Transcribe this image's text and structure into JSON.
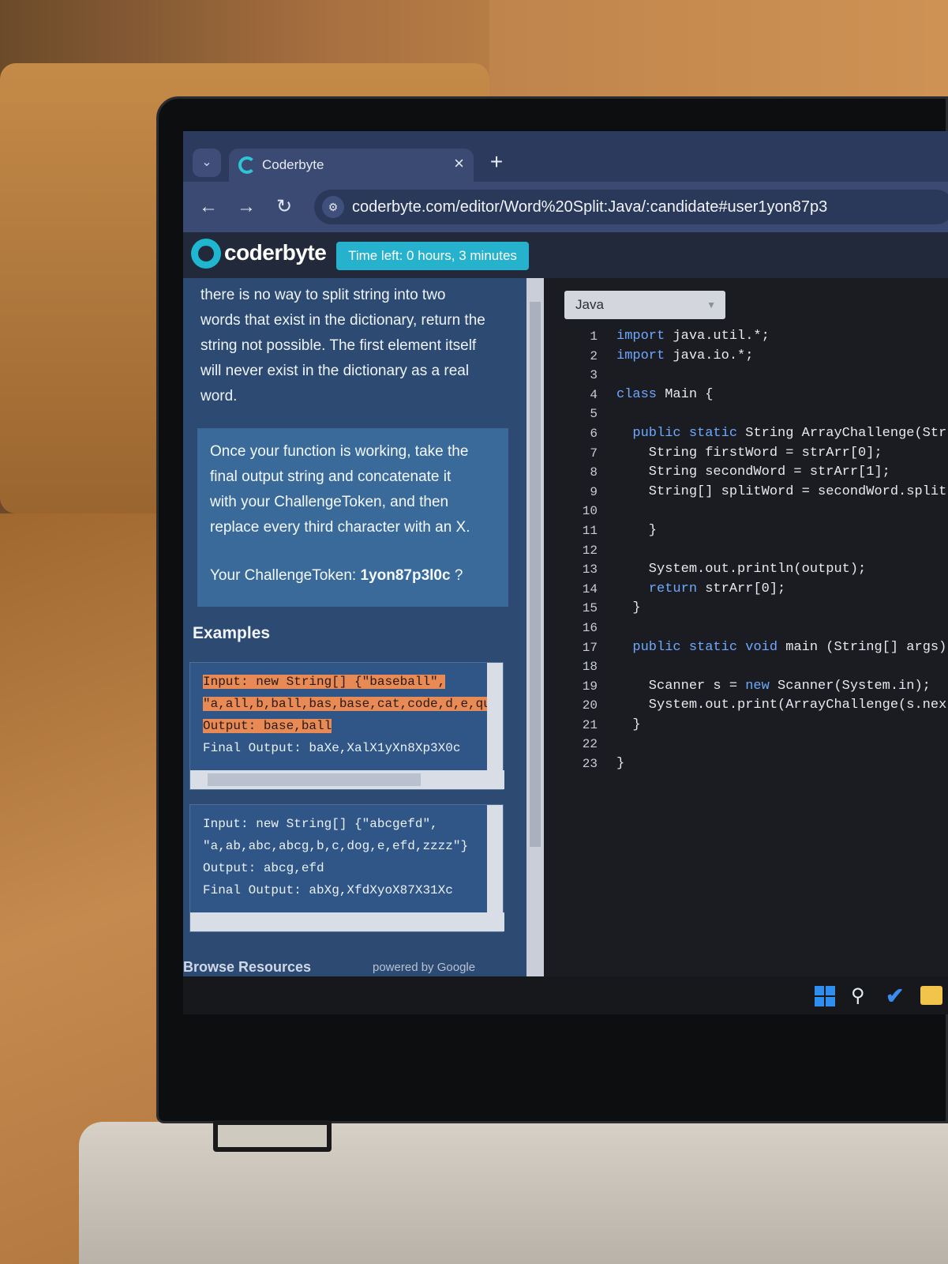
{
  "browser": {
    "tab_title": "Coderbyte",
    "url": "coderbyte.com/editor/Word%20Split:Java/:candidate#user1yon87p3"
  },
  "header": {
    "logo": "coderbyte",
    "timer": "Time left: 0 hours, 3 minutes"
  },
  "challenge": {
    "prose_lines": [
      "there is no way to split string into two",
      "words that exist in the dictionary, return the",
      "string not possible. The first element itself",
      "will never exist in the dictionary as a real",
      "word."
    ],
    "note_lines": [
      "Once your function is working, take the",
      "final output string and concatenate it",
      "with your ChallengeToken, and then",
      "replace every third character with an X."
    ],
    "token_label": "Your ChallengeToken:",
    "token_value": "1yon87p3l0c",
    "token_help": "?",
    "examples_heading": "Examples",
    "example1": [
      "Input: new String[] {\"baseball\",",
      "\"a,all,b,ball,bas,base,cat,code,d,e,qu",
      "Output: base,ball",
      "Final Output: baXe,XalX1yXn8Xp3X0c"
    ],
    "example2": [
      "Input: new String[] {\"abcgefd\",",
      "\"a,ab,abc,abcg,b,c,dog,e,efd,zzzz\"}",
      "Output: abcg,efd",
      "Final Output: abXg,XfdXyoX87X31Xc"
    ],
    "browse": "Browse Resources",
    "powered_by": "powered by Google"
  },
  "editor": {
    "language": "Java",
    "line_numbers": [
      "1",
      "2",
      "3",
      "4",
      "5",
      "6",
      "7",
      "8",
      "9",
      "10",
      "11",
      "12",
      "13",
      "14",
      "15",
      "16",
      "17",
      "18",
      "19",
      "20",
      "21",
      "22",
      "23"
    ],
    "lines": [
      "import java.util.*;",
      "import java.io.*;",
      "",
      "class Main {",
      "",
      "  public static String ArrayChallenge(Str",
      "    String firstWord = strArr[0];",
      "    String secondWord = strArr[1];",
      "    String[] splitWord = secondWord.split",
      "",
      "    }",
      "",
      "    System.out.println(output);",
      "    return strArr[0];",
      "  }",
      "",
      "  public static void main (String[] args)",
      "",
      "    Scanner s = new Scanner(System.in);",
      "    System.out.print(ArrayChallenge(s.nex",
      "  }",
      "",
      "}"
    ]
  },
  "colors": {
    "accent": "#26b2cc",
    "keyword": "#6ea8ff",
    "highlight": "#e78a55"
  }
}
